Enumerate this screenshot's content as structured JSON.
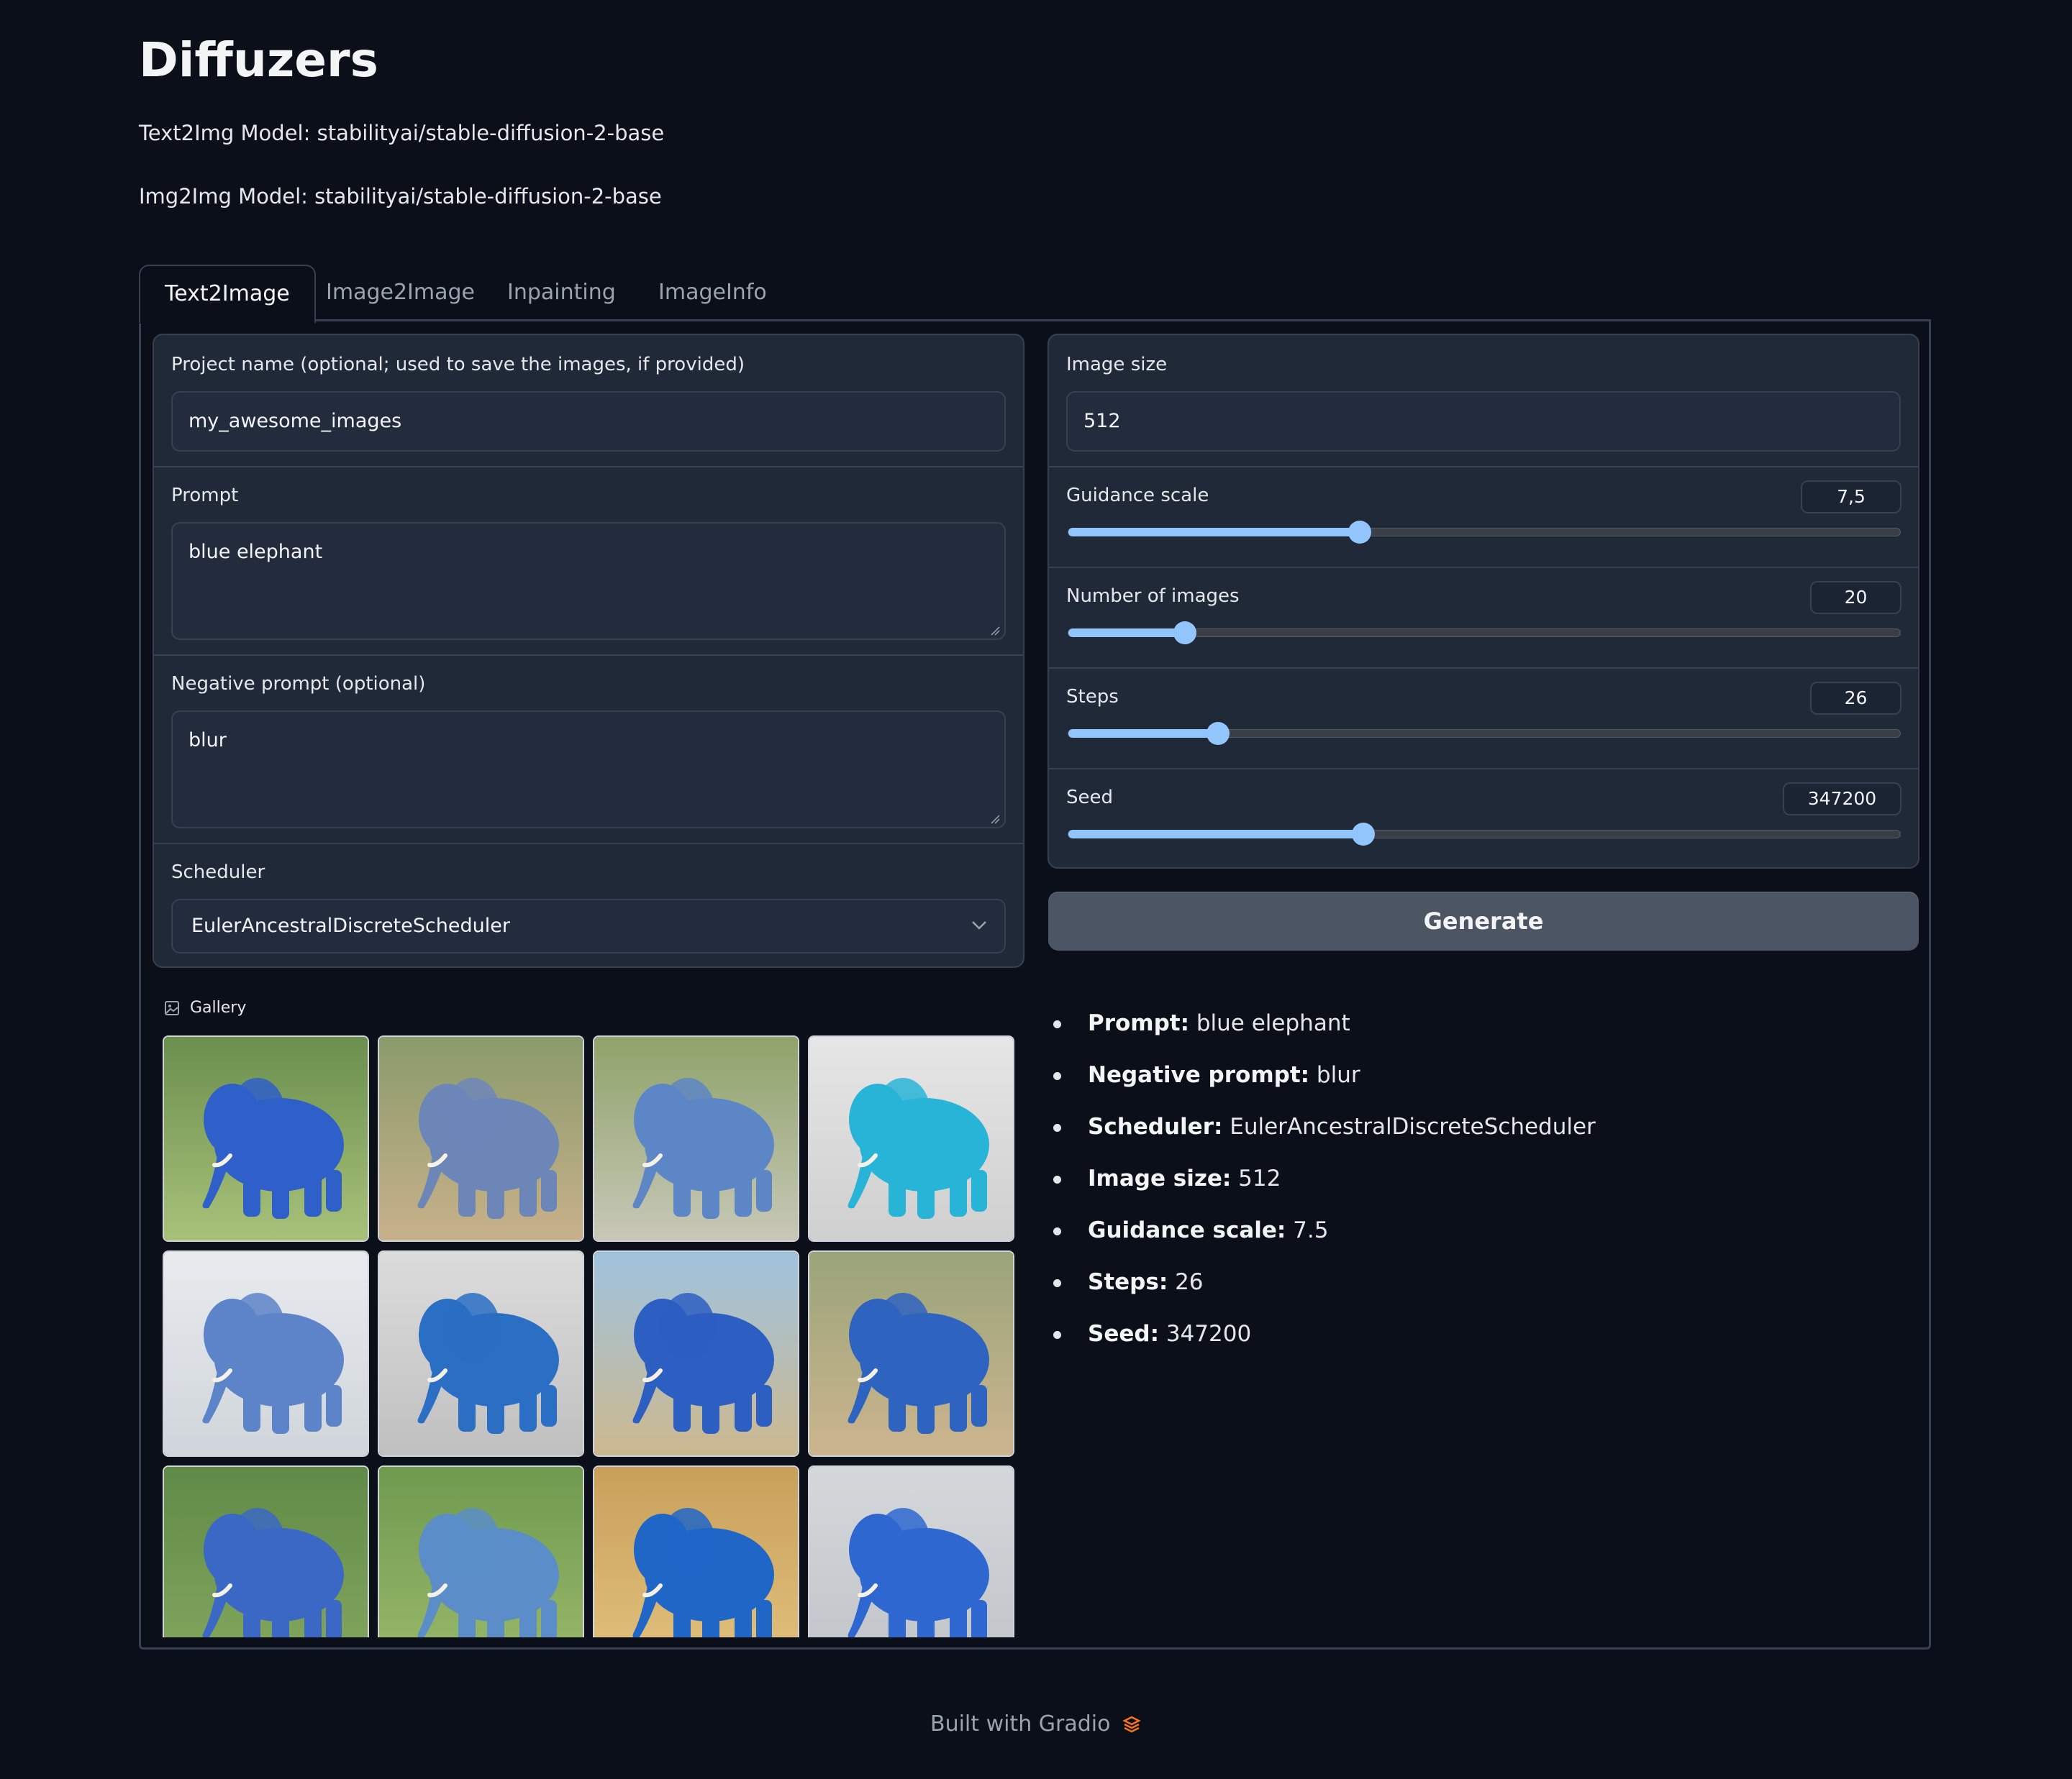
{
  "header": {
    "title": "Diffuzers",
    "text2img_model": "Text2Img Model: stabilityai/stable-diffusion-2-base",
    "img2img_model": "Img2Img Model: stabilityai/stable-diffusion-2-base"
  },
  "tabs": [
    "Text2Image",
    "Image2Image",
    "Inpainting",
    "ImageInfo"
  ],
  "active_tab": "Text2Image",
  "left": {
    "project_name": {
      "label": "Project name (optional; used to save the images, if provided)",
      "value": "my_awesome_images"
    },
    "prompt": {
      "label": "Prompt",
      "value": "blue elephant"
    },
    "negative_prompt": {
      "label": "Negative prompt (optional)",
      "value": "blur"
    },
    "scheduler": {
      "label": "Scheduler",
      "value": "EulerAncestralDiscreteScheduler"
    }
  },
  "right": {
    "image_size": {
      "label": "Image size",
      "value": "512"
    },
    "guidance_scale": {
      "label": "Guidance scale",
      "value": "7,5",
      "level": 0.35
    },
    "num_images": {
      "label": "Number of images",
      "value": "20",
      "level": 0.14
    },
    "steps": {
      "label": "Steps",
      "value": "26",
      "level": 0.18
    },
    "seed": {
      "label": "Seed",
      "value": "347200",
      "level": 0.355
    }
  },
  "generate_label": "Generate",
  "gallery_label": "Gallery",
  "info": [
    {
      "key": "Prompt:",
      "value": "blue elephant"
    },
    {
      "key": "Negative prompt:",
      "value": "blur"
    },
    {
      "key": "Scheduler:",
      "value": "EulerAncestralDiscreteScheduler"
    },
    {
      "key": "Image size:",
      "value": "512"
    },
    {
      "key": "Guidance scale:",
      "value": "7.5"
    },
    {
      "key": "Steps:",
      "value": "26"
    },
    {
      "key": "Seed:",
      "value": "347200"
    }
  ],
  "footer": "Built with Gradio",
  "colors": {
    "background": "#0b0f19",
    "panel": "#1f2937",
    "accent": "#93c5fd",
    "gradio_logo": "#f97316"
  }
}
